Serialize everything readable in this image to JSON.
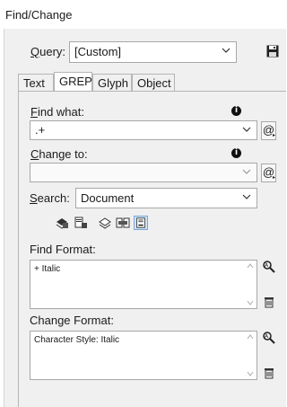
{
  "window": {
    "title": "Find/Change"
  },
  "query": {
    "label": "Query:",
    "value": "[Custom]"
  },
  "icons": {
    "save": "floppy-disk-icon",
    "special_chars": "at-sign-icon",
    "info": "info-icon",
    "format": "format-icon",
    "clear": "trash-icon"
  },
  "tabs": [
    {
      "label": "Text",
      "active": false
    },
    {
      "label": "GREP",
      "active": true
    },
    {
      "label": "Glyph",
      "active": false
    },
    {
      "label": "Object",
      "active": false
    }
  ],
  "find_what": {
    "label": "Find what:",
    "value": ".+"
  },
  "change_to": {
    "label": "Change to:",
    "value": ""
  },
  "search": {
    "label": "Search:",
    "value": "Document"
  },
  "find_format": {
    "label": "Find Format:",
    "value": "+ Italic"
  },
  "change_format": {
    "label": "Change Format:",
    "value": "Character Style: Italic"
  }
}
